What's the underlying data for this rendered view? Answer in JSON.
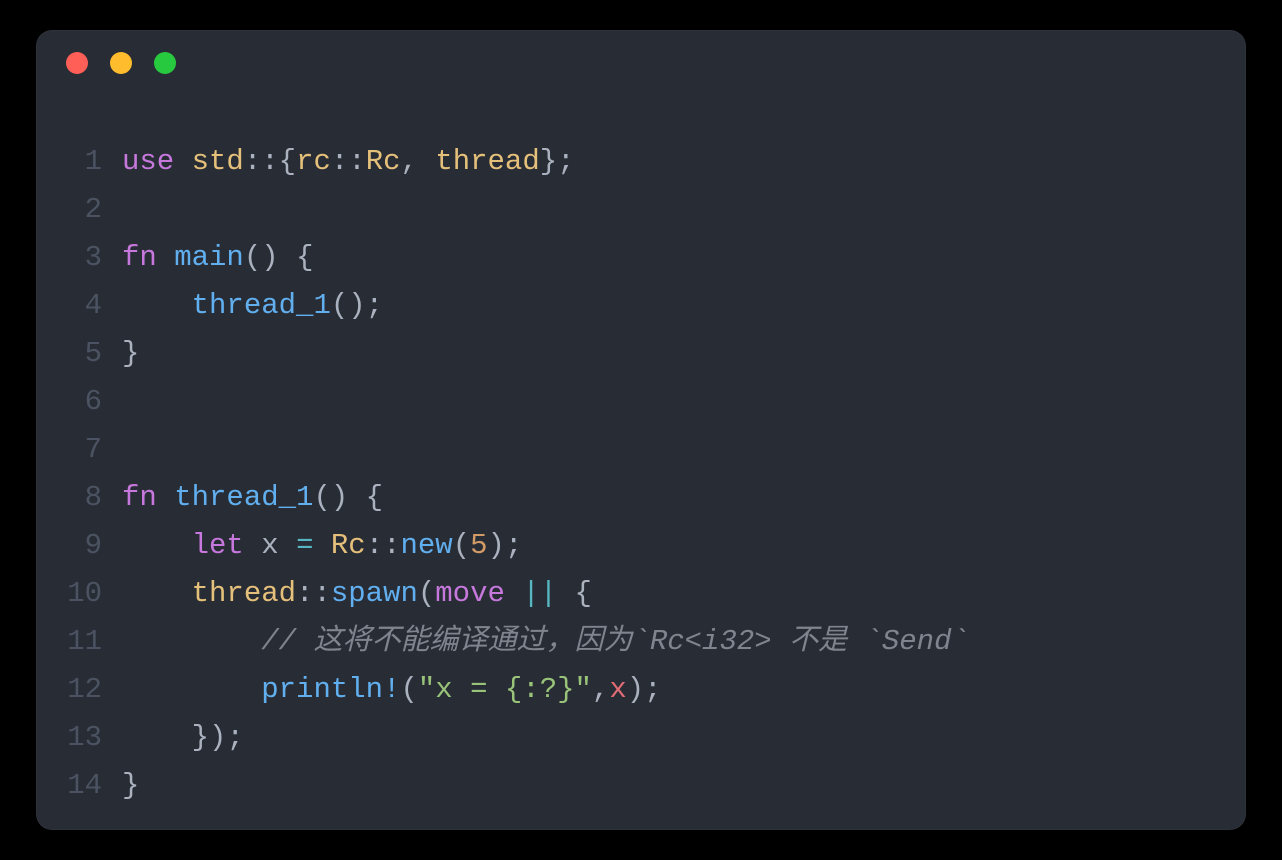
{
  "window": {
    "dots": {
      "red": "#ff5f56",
      "yellow": "#ffbd2e",
      "green": "#27c93f"
    }
  },
  "gutter": {
    "l1": "1",
    "l2": "2",
    "l3": "3",
    "l4": "4",
    "l5": "5",
    "l6": "6",
    "l7": "7",
    "l8": "8",
    "l9": "9",
    "l10": "10",
    "l11": "11",
    "l12": "12",
    "l13": "13",
    "l14": "14"
  },
  "code": {
    "l1": {
      "use": "use",
      "sp1": " ",
      "std": "std",
      "cc1": "::",
      "lb": "{",
      "rc_mod": "rc",
      "cc2": "::",
      "Rc": "Rc",
      "comma": ", ",
      "thread": "thread",
      "rb": "}",
      "semi": ";"
    },
    "l3": {
      "fn": "fn",
      "sp": " ",
      "main": "main",
      "paren": "()",
      "sp2": " ",
      "lb": "{"
    },
    "l4": {
      "indent": "    ",
      "thread_1": "thread_1",
      "paren": "()",
      "semi": ";"
    },
    "l5": {
      "rb": "}"
    },
    "l8": {
      "fn": "fn",
      "sp": " ",
      "thread_1": "thread_1",
      "paren": "()",
      "sp2": " ",
      "lb": "{"
    },
    "l9": {
      "indent": "    ",
      "let": "let",
      "sp": " ",
      "x": "x",
      "sp2": " ",
      "eq": "=",
      "sp3": " ",
      "Rc": "Rc",
      "cc": "::",
      "new": "new",
      "lp": "(",
      "five": "5",
      "rp": ")",
      "semi": ";"
    },
    "l10": {
      "indent": "    ",
      "thread": "thread",
      "cc": "::",
      "spawn": "spawn",
      "lp": "(",
      "move": "move",
      "sp": " ",
      "bars": "||",
      "sp2": " ",
      "lb": "{"
    },
    "l11": {
      "indent": "        ",
      "comment": "// 这将不能编译通过，因为`Rc<i32> 不是 `Send`"
    },
    "l12": {
      "indent": "        ",
      "println": "println!",
      "lp": "(",
      "str": "\"x = {:?}\"",
      "comma": ",",
      "x": "x",
      "rp": ")",
      "semi": ";"
    },
    "l13": {
      "indent": "    ",
      "rb": "}",
      "rp": ")",
      "semi": ";"
    },
    "l14": {
      "rb": "}"
    }
  }
}
